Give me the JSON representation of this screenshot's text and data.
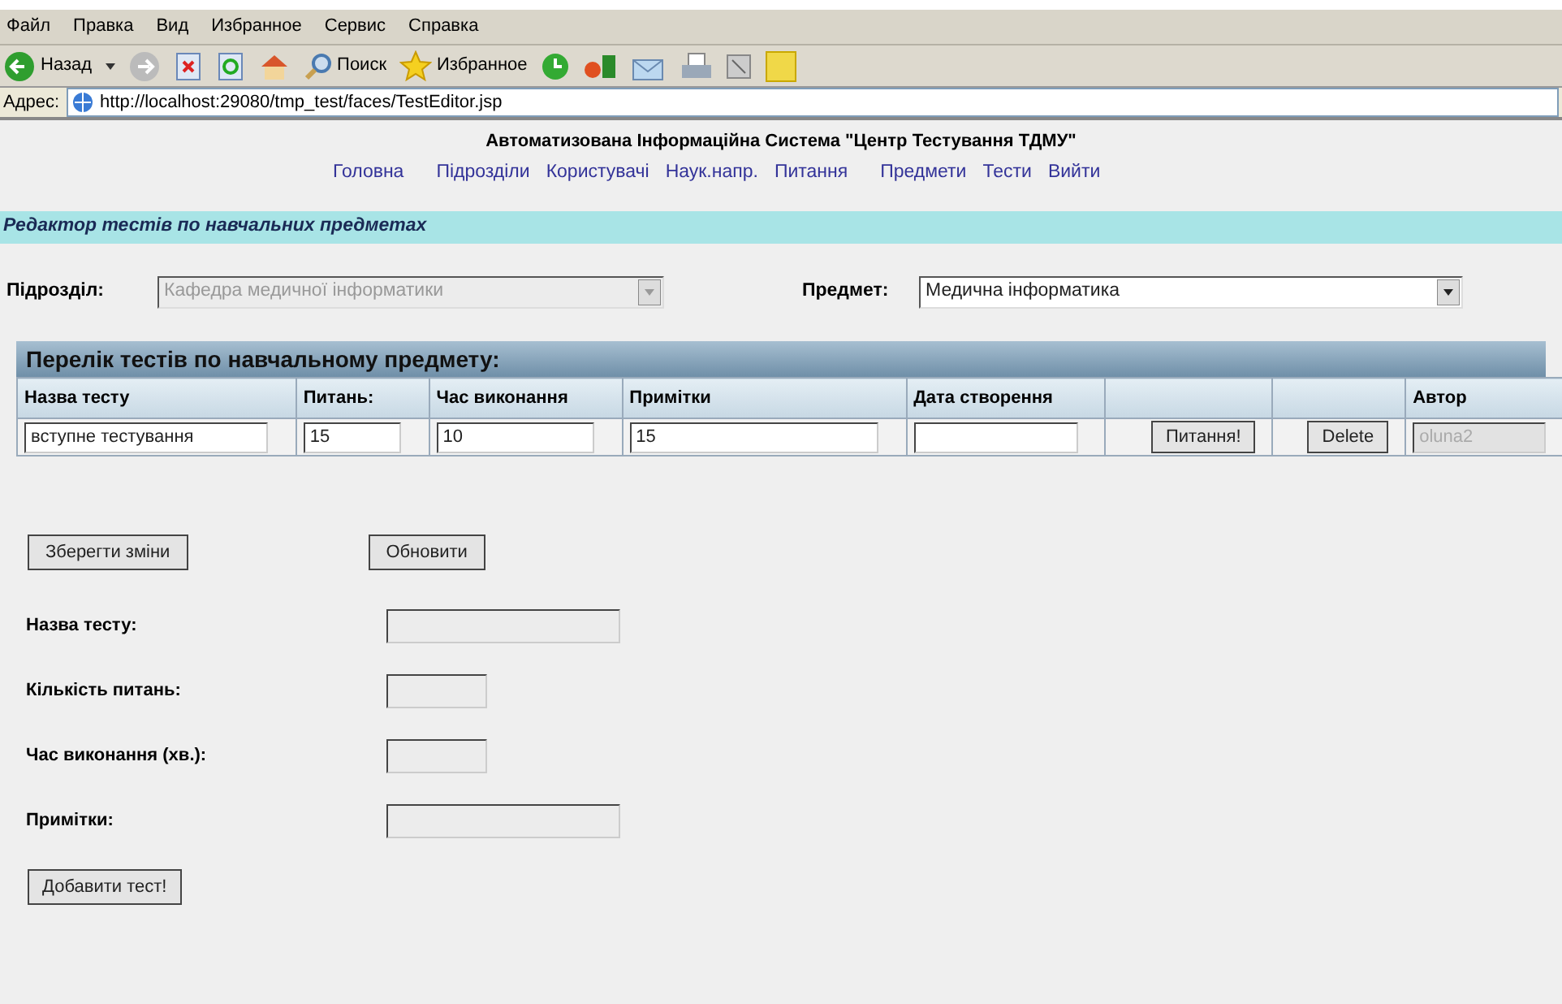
{
  "menu_bar": [
    "Файл",
    "Правка",
    "Вид",
    "Избранное",
    "Сервис",
    "Справка"
  ],
  "toolbar": {
    "back": "Назад",
    "search": "Поиск",
    "favorites": "Избранное"
  },
  "address_bar": {
    "label": "Адрес:",
    "url": "http://localhost:29080/tmp_test/faces/TestEditor.jsp"
  },
  "site_title": "Автоматизована Інформаційна Система \"Центр Тестування ТДМУ\"",
  "nav": [
    "Головна",
    "Підрозділи",
    "Користувачі",
    "Наук.напр.",
    "Питання",
    "Предмети",
    "Тести",
    "Вийти"
  ],
  "section_title": "Редактор тестів по навчальних предметах",
  "filters": [
    {
      "label": "Підрозділ:",
      "value": "Кафедра медичної інформатики",
      "disabled": true
    },
    {
      "label": "Предмет:",
      "value": "Медична інформатика",
      "disabled": false
    }
  ],
  "table": {
    "title": "Перелік тестів по навчальному предмету:",
    "columns": [
      "Назва тесту",
      "Питань:",
      "Час виконання",
      "Примітки",
      "Дата створення",
      "",
      "",
      "Автор"
    ],
    "rows": [
      {
        "cells": [
          {
            "kind": "field",
            "value": "вступне тестування",
            "disabled": false
          },
          {
            "kind": "field",
            "value": "15",
            "disabled": false
          },
          {
            "kind": "field",
            "value": "10",
            "disabled": false
          },
          {
            "kind": "field",
            "value": "15",
            "disabled": false
          },
          {
            "kind": "field",
            "disabled": false
          },
          {
            "kind": "button",
            "value": "Питання!"
          },
          {
            "kind": "button",
            "value": "Delete"
          },
          {
            "kind": "field",
            "value": "oluna2",
            "disabled": true
          }
        ]
      }
    ]
  },
  "actions": [
    "Зберегти зміни",
    "Обновити"
  ],
  "form": [
    {
      "label": "Назва тесту:",
      "kind": "long"
    },
    {
      "label": "Кількість питань:",
      "kind": "short"
    },
    {
      "label": "Час виконання (хв.):",
      "kind": "short"
    },
    {
      "label": "Примітки:",
      "kind": "long"
    }
  ],
  "submit": "Добавити тест!"
}
